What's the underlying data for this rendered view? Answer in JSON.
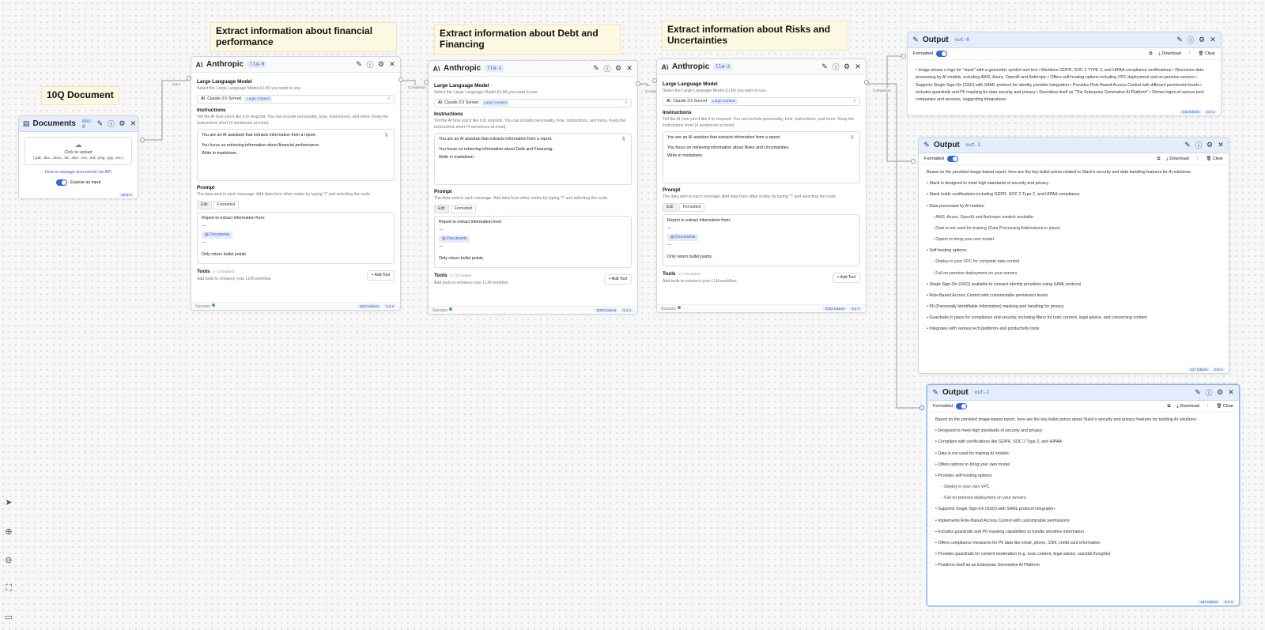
{
  "notes": {
    "doc": "10Q Document",
    "fin": "Extract information about financial performance",
    "debt": "Extract information about Debt and Financing",
    "risk": "Extract information about Risks and Uncertainties"
  },
  "documents": {
    "title": "Documents",
    "badge": "doc-0",
    "upload": "Click to upload",
    "formats": "(.pdf, .doc, .docx, .txt, .xlsx, .csv, .md, .png, .jpg, .etc.)",
    "link": "How to manage documents via API",
    "expose": "Expose as input",
    "time": "18.3 s"
  },
  "edges": {
    "input": "Input",
    "completion": "Completion"
  },
  "llm": {
    "title": "Anthropic",
    "section_model": "Large Language Model",
    "model_desc": "Select the Large Language Model (LLM) you want to use.",
    "model": "Claude 3.5 Sonnet",
    "model_tag": "Large Context",
    "section_instr": "Instructions",
    "instr_desc": "Tell the AI how you'd like it to respond. You can include personality, tone, instructions, and more. Keep the instructions short (4 sentences at most).",
    "section_prompt": "Prompt",
    "prompt_desc": "The data sent in each message. Add data from other nodes by typing \"/\" and selecting the node.",
    "tab_edit": "Edit",
    "tab_formatted": "Formatted",
    "prompt_line1": "Report to extract information from:",
    "prompt_sep": "---",
    "prompt_chip": "Documents",
    "prompt_line2": "Only return bullet points.",
    "section_tools": "Tools",
    "tools_count": "0 / 3 Enabled",
    "tools_desc": "Add tools to enhance your LLM workflow.",
    "add_tool": "Add Tool",
    "status": "Success"
  },
  "llm_nodes": [
    {
      "badge": "llm-0",
      "instr1": "You are an AI assistant that extracts information from a report.",
      "instr2": "You focus on retrieving information about financial performance.",
      "instr3": "Write in markdown.",
      "tokens": "1627 tokens",
      "time": "4.4 s"
    },
    {
      "badge": "llm-1",
      "instr1": "You are an AI assistan that extracts information from a report.",
      "instr2": "You focus on retrieving information about Debt and Financing.",
      "instr3": "Write in markdown.",
      "tokens": "2000 tokens",
      "time": "5.1 s"
    },
    {
      "badge": "llm-2",
      "instr1": "You are an AI assistan that extracts information from a report.",
      "instr2": "You focus on retrieving information about Risks and Uncertainties.",
      "instr3": "Write in markdown.",
      "tokens": "2004 tokens",
      "time": "5.4 s"
    }
  ],
  "output": {
    "title": "Output",
    "formatted": "Formatted",
    "download": "Download",
    "clear": "Clear"
  },
  "out0": {
    "badge": "out-0",
    "text": "• Image shows a logo for \"stack\" with a geometric symbol and text • Mentions GDPR, SOC 2 TYPE 2, and HIPAA compliance certifications • Discusses data processing by AI models, including AWS, Azure, OpenAI and Anthropic • Offers self-hosting options including VPC deployment and on-premise servers • Supports Single Sign-On (SSO) with SAML protocol for identity provider integration • Provides Role Based Access Control with different permission levels • Includes guardrails and PII masking for data security and privacy • Describes itself as \"The Enterprise Generative AI Platform\" • Shows logos of various tech companies and services, suggesting integrations",
    "tokens": "145 tokens",
    "time": "3.0 s"
  },
  "out1": {
    "badge": "out-1",
    "intro": "Based on the provided image-based report, here are the key bullet points related to Stack's security and data handling features for AI solutions:",
    "items": [
      {
        "t": "• Stack is designed to meet high standards of security and privacy",
        "s": 0
      },
      {
        "t": "• Stack holds certifications including GDPR, SOC 2 Type 2, and HIPAA compliance",
        "s": 0
      },
      {
        "t": "• Data processed by AI models:",
        "s": 0
      },
      {
        "t": "- AWS, Azure, OpenAI and Anthropic models available",
        "s": 1
      },
      {
        "t": "- Data is not used for training (Data Processing Addendums in place)",
        "s": 1
      },
      {
        "t": "- Option to bring your own model",
        "s": 1
      },
      {
        "t": "• Self-hosting options:",
        "s": 0
      },
      {
        "t": "- Deploy in your VPC for complete data control",
        "s": 1
      },
      {
        "t": "- Full on-premise deployment on your servers",
        "s": 1
      },
      {
        "t": "• Single Sign-On (SSO) available to connect identity providers using SAML protocol",
        "s": 0
      },
      {
        "t": "• Role-Based Access Control with customizable permission levels",
        "s": 0
      },
      {
        "t": "• PII (Personally Identifiable Information) masking and handling for privacy",
        "s": 0
      },
      {
        "t": "• Guardrails in place for compliance and security, including filters for toxic content, legal advice, and concerning content",
        "s": 0
      },
      {
        "t": "• Integrates with various tech platforms and productivity tools",
        "s": 0
      }
    ],
    "tokens": "217 tokens",
    "time": "6.0 s"
  },
  "out2": {
    "badge": "out-2",
    "intro": "Based on the provided image-based report, here are the key bullet points about Stack's security and privacy features for building AI solutions:",
    "items": [
      {
        "t": "• Designed to meet high standards of security and privacy",
        "s": 0
      },
      {
        "t": "• Compliant with certifications like GDPR, SOC 2 Type 2, and HIPAA",
        "s": 0
      },
      {
        "t": "• Data is not used for training AI models",
        "s": 0
      },
      {
        "t": "• Offers options to bring your own model",
        "s": 0
      },
      {
        "t": "• Provides self-hosting options:",
        "s": 0
      },
      {
        "t": "- Deploy in your own VPC",
        "s": 1
      },
      {
        "t": "- Full on-premise deployment on your servers",
        "s": 1
      },
      {
        "t": "• Supports Single Sign-On (SSO) with SAML protocol integration",
        "s": 0
      },
      {
        "t": "• Implements Role-Based Access Control with customizable permissions",
        "s": 0
      },
      {
        "t": "• Includes guardrails and PII masking capabilities to handle sensitive information",
        "s": 0
      },
      {
        "t": "• Offers compliance measures for PII data like email, phone, SSN, credit card information",
        "s": 0
      },
      {
        "t": "• Provides guardrails for content moderation (e.g. toxic content, legal advice, suicidal thoughts)",
        "s": 0
      },
      {
        "t": "• Positions itself as an Enterprise Generative AI Platform",
        "s": 0
      }
    ],
    "tokens": "187 tokens",
    "time": "5.2 s"
  },
  "toolbar": [
    "pointer-icon",
    "zoom-in-icon",
    "zoom-out-icon",
    "fit-view-icon",
    "minimap-icon"
  ]
}
